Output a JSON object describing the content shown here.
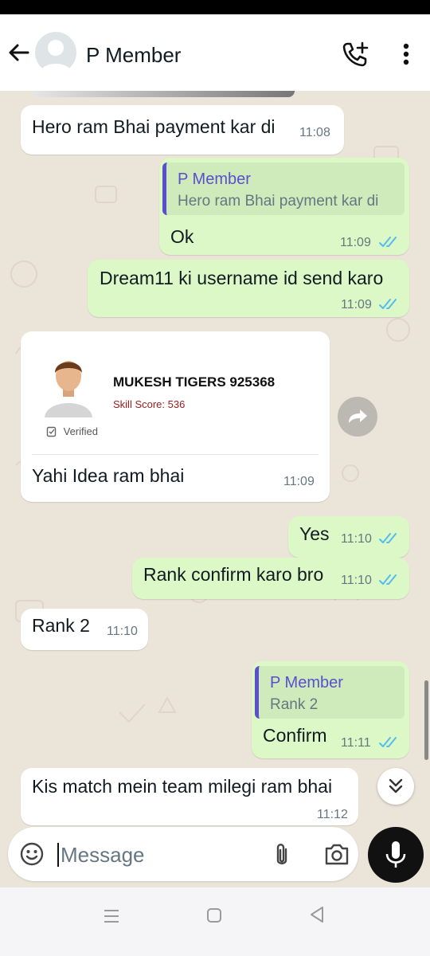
{
  "header": {
    "contact_name": "P Member",
    "icons": {
      "back": "arrow-left-icon",
      "avatar": "default-avatar-icon",
      "call": "add-call-icon",
      "menu": "more-vertical-icon"
    }
  },
  "messages": [
    {
      "direction": "in",
      "text": "Hero ram Bhai payment kar di",
      "time": "11:08"
    },
    {
      "direction": "out",
      "quote_author": "P Member",
      "quote_text": "Hero ram Bhai payment kar di",
      "text": "Ok",
      "time": "11:09",
      "status": "read"
    },
    {
      "direction": "out",
      "text": "Dream11 ki username id send karo",
      "time": "11:09",
      "status": "read"
    },
    {
      "direction": "in",
      "type": "image",
      "card": {
        "name": "MUKESH TIGERS 925368",
        "score": "Skill Score: 536",
        "verified": "Verified"
      },
      "text": "Yahi Idea ram bhai",
      "time": "11:09"
    },
    {
      "direction": "out",
      "text": "Yes",
      "time": "11:10",
      "status": "read"
    },
    {
      "direction": "out",
      "text": "Rank confirm karo bro",
      "time": "11:10",
      "status": "read"
    },
    {
      "direction": "in",
      "text": "Rank 2",
      "time": "11:10"
    },
    {
      "direction": "out",
      "quote_author": "P Member",
      "quote_text": "Rank 2",
      "text": "Confirm",
      "time": "11:11",
      "status": "read"
    },
    {
      "direction": "in",
      "text": "Kis match mein team milegi ram bhai",
      "time": "11:12"
    }
  ],
  "input": {
    "placeholder": "Message",
    "icons": {
      "emoji": "emoji-icon",
      "attach": "paperclip-icon",
      "camera": "camera-icon",
      "mic": "mic-icon"
    }
  },
  "floating": {
    "forward": "forward-icon",
    "scroll_down": "double-chevron-down-icon"
  },
  "colors": {
    "incoming_bubble": "#ffffff",
    "outgoing_bubble": "#dcf8c6",
    "read_ticks": "#53bdeb",
    "quote_accent": "#5a4fcf",
    "chat_background": "#ebe4d8"
  }
}
